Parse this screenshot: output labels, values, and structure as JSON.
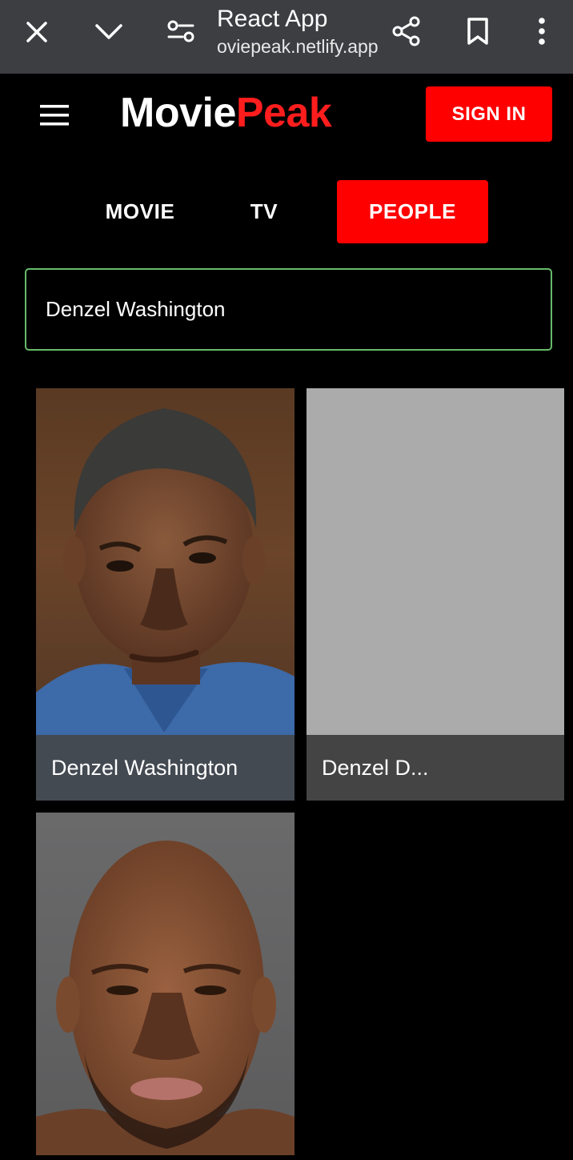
{
  "browser": {
    "title": "React App",
    "url": "oviepeak.netlify.app",
    "icons": [
      "close-icon",
      "chevron-down-icon",
      "site-settings-icon",
      "share-icon",
      "bookmark-icon",
      "more-vert-icon"
    ]
  },
  "header": {
    "logo_part1": "Movie",
    "logo_part2": "Peak",
    "signin_label": "SIGN IN",
    "menu_icon": "hamburger-menu-icon"
  },
  "tabs": [
    {
      "label": "MOVIE",
      "active": false
    },
    {
      "label": "TV",
      "active": false
    },
    {
      "label": "PEOPLE",
      "active": true
    }
  ],
  "search": {
    "value": "Denzel Washington"
  },
  "results": [
    {
      "name": "Denzel Washington",
      "has_image": true
    },
    {
      "name": "Denzel D...",
      "has_image": false
    },
    {
      "name": "",
      "has_image": true
    }
  ],
  "colors": {
    "accent": "#ff0000",
    "browser_bar": "#3c3e42",
    "background": "#000000",
    "search_border": "#66bb6a",
    "placeholder_card": "#ababab"
  }
}
